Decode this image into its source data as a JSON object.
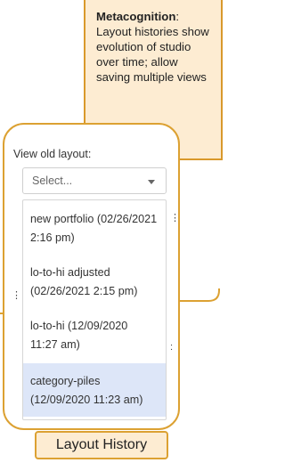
{
  "note": {
    "bold": "Metacognition",
    "text": ": Layout histories show evolution of studio over time; allow saving multiple views"
  },
  "panel": {
    "title": "View old layout:",
    "select_placeholder": "Select...",
    "options": [
      {
        "line1": "new portfolio (02/26/2021",
        "line2": "2:16 pm)"
      },
      {
        "line1": "lo-to-hi adjusted",
        "line2": "(02/26/2021 2:15 pm)"
      },
      {
        "line1": "lo-to-hi (12/09/2020",
        "line2": "11:27 am)"
      },
      {
        "line1": "category-piles",
        "line2": "(12/09/2020 11:23 am)"
      }
    ],
    "selected_index": 3
  },
  "label": "Layout History",
  "colors": {
    "accent": "#dca132",
    "note_fill": "#fdecd2",
    "selected": "#dde6f8"
  }
}
